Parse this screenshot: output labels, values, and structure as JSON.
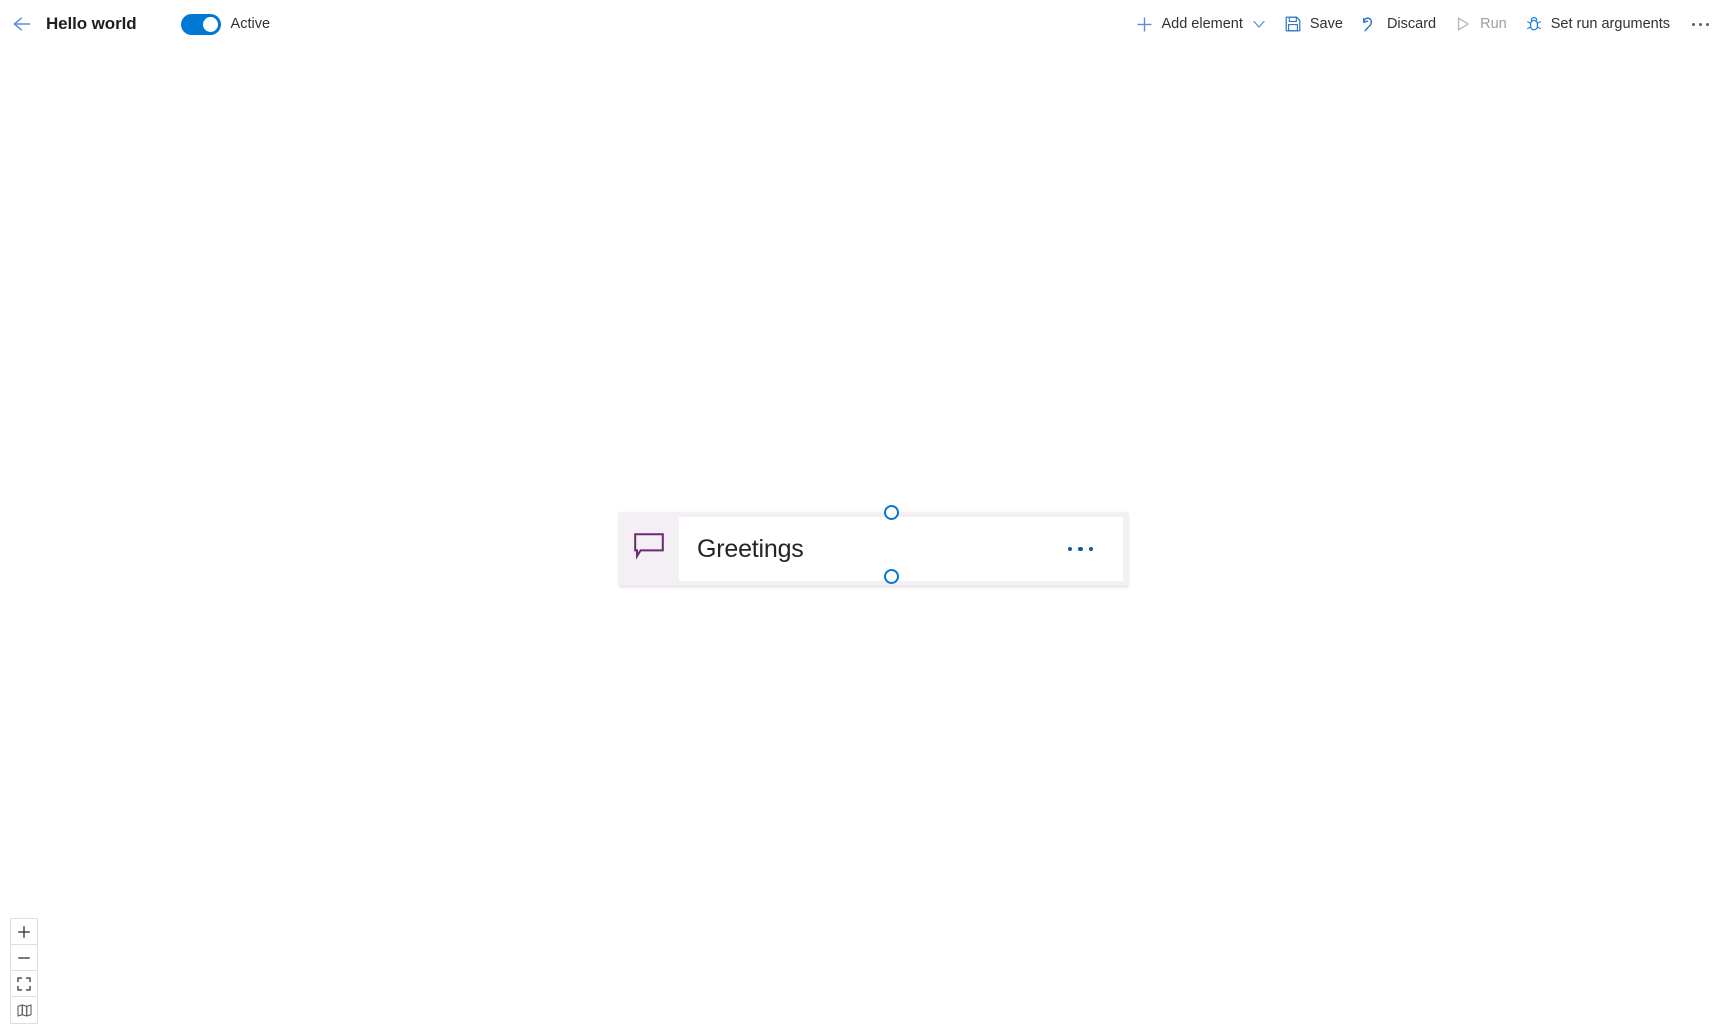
{
  "header": {
    "back_icon": "back-arrow-icon",
    "title": "Hello world",
    "toggle": {
      "label": "Active",
      "state": "on",
      "accent": "#0078d4"
    },
    "commands": [
      {
        "id": "add-element",
        "icon": "plus-icon",
        "label": "Add element",
        "has_chevron": true,
        "disabled": false
      },
      {
        "id": "save",
        "icon": "save-icon",
        "label": "Save",
        "has_chevron": false,
        "disabled": false
      },
      {
        "id": "discard",
        "icon": "undo-icon",
        "label": "Discard",
        "has_chevron": false,
        "disabled": false
      },
      {
        "id": "run",
        "icon": "play-icon",
        "label": "Run",
        "has_chevron": false,
        "disabled": true
      },
      {
        "id": "set-run-arguments",
        "icon": "bug-icon",
        "label": "Set run arguments",
        "has_chevron": false,
        "disabled": false
      }
    ],
    "overflow_icon": "ellipsis-icon"
  },
  "canvas": {
    "node": {
      "icon": "speech-bubble-icon",
      "icon_color": "#6b2a72",
      "icon_bg": "#f3eff5",
      "title": "Greetings",
      "menu_icon": "ellipsis-icon",
      "menu_color": "#0f5a9e",
      "selected": true,
      "handle_color": "#0078d4"
    }
  },
  "zoom_controls": [
    {
      "id": "zoom-in",
      "icon": "plus-icon"
    },
    {
      "id": "zoom-out",
      "icon": "minus-icon"
    },
    {
      "id": "fit-to-screen",
      "icon": "fit-screen-icon"
    },
    {
      "id": "minimap",
      "icon": "map-icon"
    }
  ]
}
